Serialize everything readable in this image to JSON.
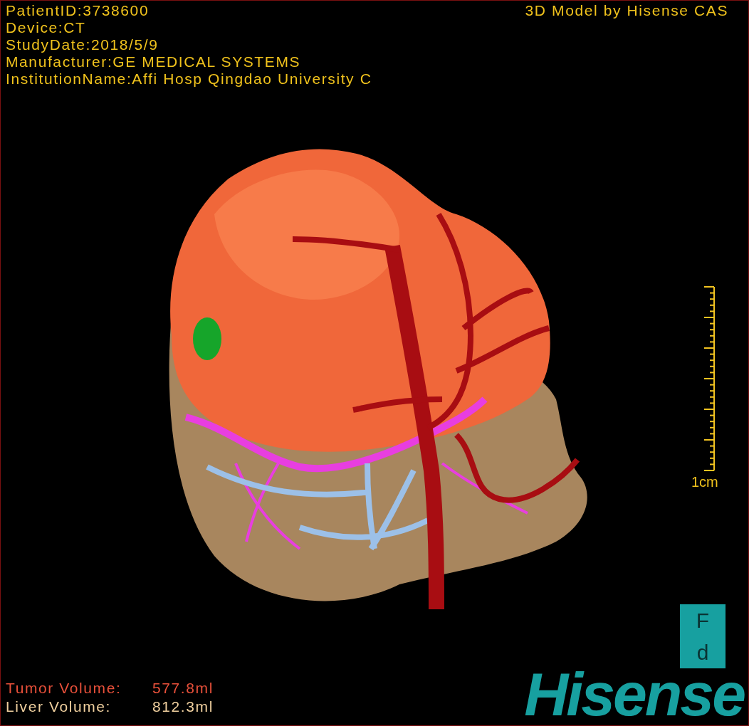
{
  "info_lines": [
    "PatientID:3738600",
    "Device:CT",
    "StudyDate:2018/5/9",
    "Manufacturer:GE MEDICAL SYSTEMS",
    "InstitutionName:Affi Hosp Qingdao University C"
  ],
  "title": "3D Model by Hisense CAS",
  "scale_bar": {
    "label": "1cm"
  },
  "orientation_cube": {
    "top": "F",
    "bottom": "d"
  },
  "volumes": [
    {
      "kind": "tumor",
      "label": "Tumor Volume:",
      "value": "577.8ml"
    },
    {
      "kind": "liver",
      "label": "Liver Volume:",
      "value": "812.3ml"
    }
  ],
  "logo": "Hisense"
}
